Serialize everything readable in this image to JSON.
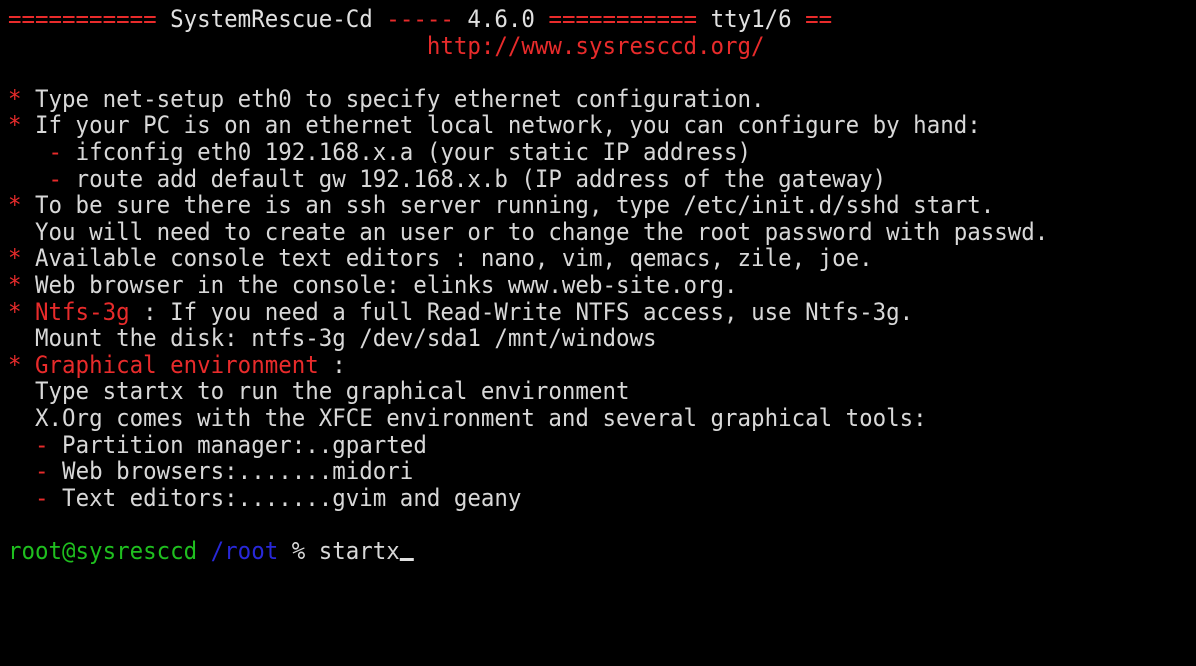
{
  "colors": {
    "background": "#000000",
    "text": "#e0e0e0",
    "accent_red": "#e82b2b",
    "prompt_green": "#1fbf1f",
    "path_blue": "#2828d8"
  },
  "header": {
    "rule_left": "===========",
    "product": "SystemRescue-Cd",
    "rule_mid": "-----",
    "version": "4.6.0",
    "rule_right": "===========",
    "tty": "tty1/6",
    "rule_end": "==",
    "url": "http://www.sysresccd.org/"
  },
  "bullet_star": "*",
  "bullet_dash": "-",
  "info": {
    "net_setup": "Type net-setup eth0 to specify ethernet configuration.",
    "local_network": "If your PC is on an ethernet local network, you can configure by hand:",
    "ifconfig": "ifconfig eth0 192.168.x.a (your static IP address)",
    "route": "route add default gw 192.168.x.b (IP address of the gateway)",
    "ssh": "To be sure there is an ssh server running, type /etc/init.d/sshd start.",
    "ssh_note": "You will need to create an user or to change the root password with passwd.",
    "editors": "Available console text editors : nano, vim, qemacs, zile, joe.",
    "browser": "Web browser in the console: elinks www.web-site.org.",
    "ntfs_name": "Ntfs-3g",
    "ntfs_text": " : If you need a full Read-Write NTFS access, use Ntfs-3g.",
    "ntfs_mount": "Mount the disk: ntfs-3g /dev/sda1 /mnt/windows",
    "graphical_name": "Graphical environment",
    "graphical_colon": " :",
    "startx_hint": "Type startx to run the graphical environment",
    "xorg": "X.Org comes with the XFCE environment and several graphical tools:",
    "tool_partition": "Partition manager:..gparted",
    "tool_browsers": "Web browsers:.......midori",
    "tool_editors": "Text editors:.......gvim and geany"
  },
  "prompt": {
    "user_host": "root@sysresccd",
    "path": "/root",
    "symbol": "%",
    "command": "startx"
  }
}
